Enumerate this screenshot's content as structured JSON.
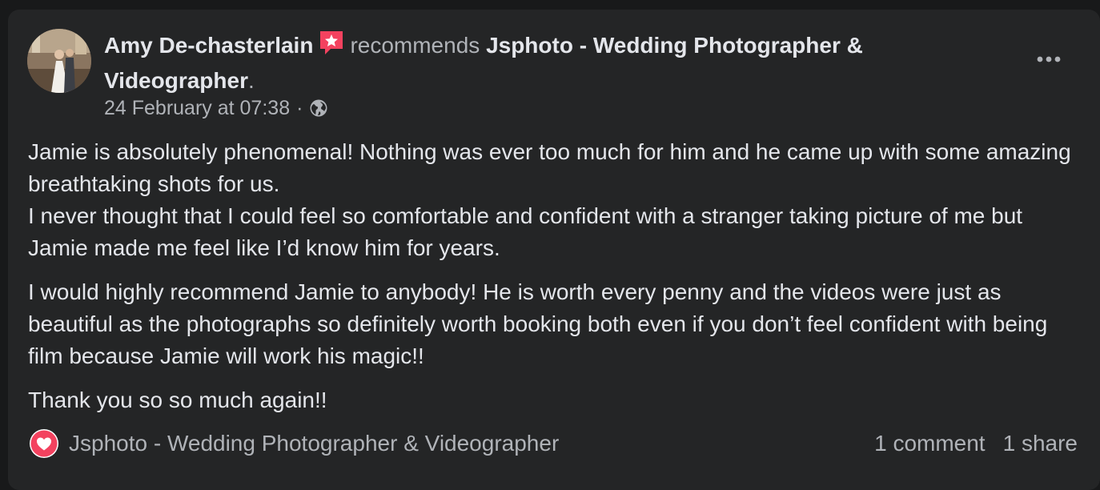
{
  "post": {
    "author": "Amy De-chasterlain",
    "verb": "recommends",
    "page_name": "Jsphoto - Wedding Photographer & Videographer",
    "period": ".",
    "timestamp": "24 February at 07:38",
    "separator": "·",
    "privacy_icon": "globe-icon",
    "recommend_icon": "star-speech-bubble-icon",
    "accent_color": "#f3425f",
    "paragraphs": [
      "Jamie is absolutely phenomenal! Nothing was ever too much for him and he came up with some amazing breathtaking shots for us.\nI never thought that I could feel so comfortable and confident with a stranger taking picture of me but Jamie made me feel like I’d know him for years.",
      "I would highly recommend Jamie to anybody! He is worth every penny and the videos were just as beautiful as the photographs so definitely worth booking both even if you don’t feel confident with being film because Jamie will work his magic!!",
      "Thank you so so much again!!"
    ]
  },
  "footer": {
    "reaction_icon": "love-heart-icon",
    "reactor": "Jsphoto - Wedding Photographer & Videographer",
    "comments": "1 comment",
    "shares": "1 share"
  },
  "menu": {
    "icon": "more-options-icon"
  }
}
